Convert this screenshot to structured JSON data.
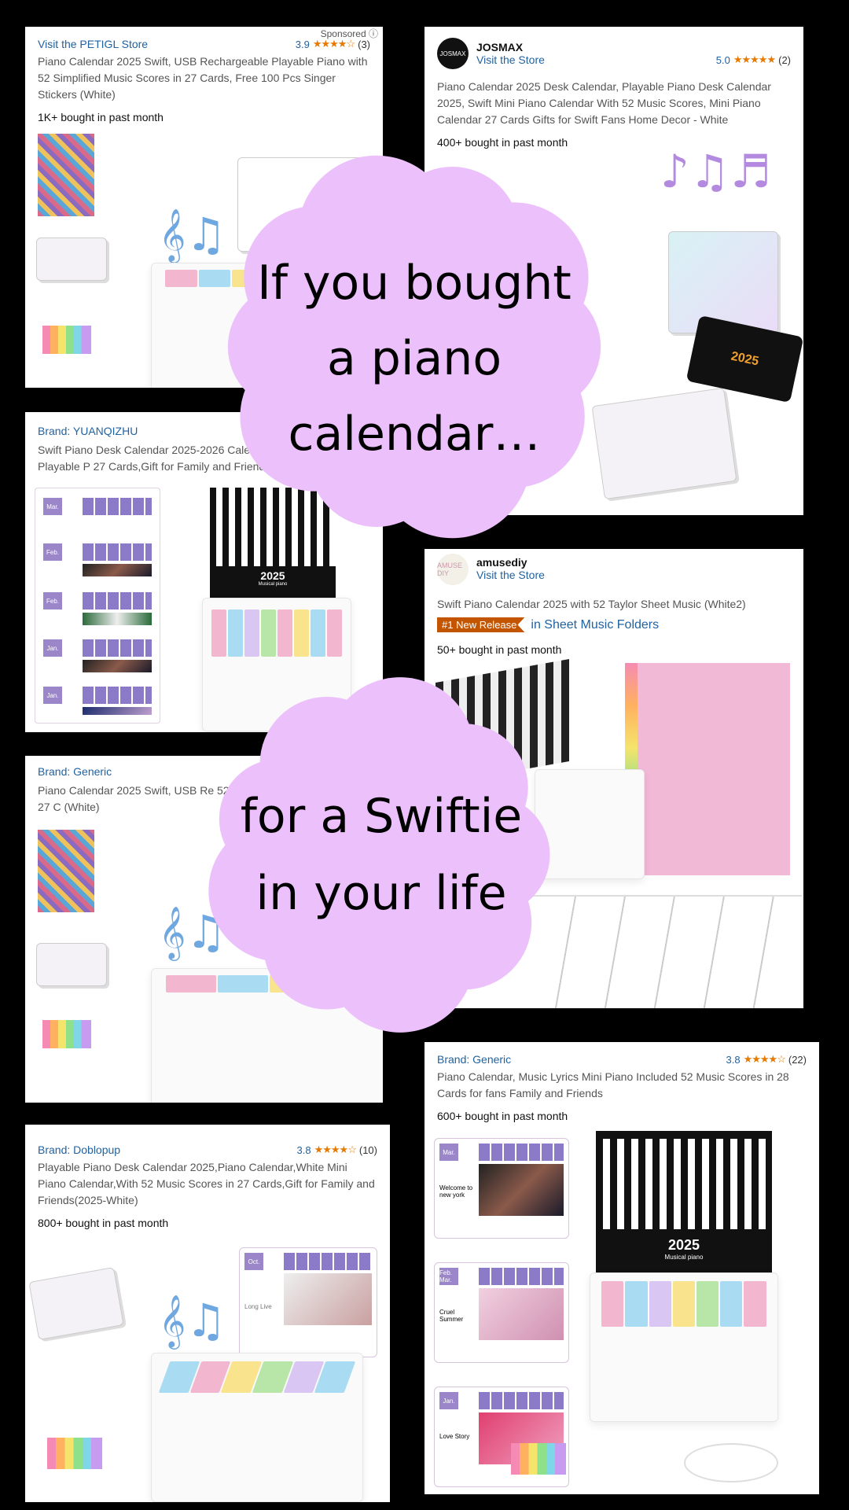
{
  "cards": [
    {
      "brand": "Visit the PETIGL Store",
      "rating": "3.9",
      "stars": "★★★★☆",
      "count": "(3)",
      "title": "Piano Calendar 2025 Swift, USB Rechargeable Playable Piano with 52 Simplified Music Scores in 27 Cards, Free 100 Pcs Singer Stickers (White)",
      "bought": "1K+ bought in past month",
      "sponsored": "Sponsored ⓘ"
    },
    {
      "store": "JOSMAX",
      "logo": "JOSMAX",
      "brand": "Visit the Store",
      "rating": "5.0",
      "stars": "★★★★★",
      "count": "(2)",
      "title": "Piano Calendar 2025 Desk Calendar, Playable Piano Desk Calendar 2025, Swift Mini Piano Calendar With 52 Music Scores, Mini Piano Calendar 27 Cards Gifts for Swift Fans Home Decor - White",
      "bought": "400+ bought in past month",
      "box_label": "2025"
    },
    {
      "brand": "Brand: YUANQIZHU",
      "title": "Swift Piano Desk Calendar 2025-2026 Calendar,USB Rechargeable Playable P 27 Cards,Gift for Family and Friends (WH",
      "months": [
        "Mar.",
        "Feb.",
        "Feb.",
        "Jan.",
        "Jan."
      ],
      "piano_year": "2025",
      "piano_sub": "Musical piano"
    },
    {
      "store": "amusediy",
      "logo": "AMUSE DIY",
      "brand": "Visit the Store",
      "title": "Swift Piano Calendar 2025 with 52 Taylor Sheet Music (White2)",
      "badge": "#1 New Release",
      "category": "in Sheet Music Folders",
      "bought": "50+ bought in past month"
    },
    {
      "brand": "Brand: Generic",
      "title": "Piano Calendar 2025 Swift, USB Re 52 Simplified Music Scores in 27 C (White)"
    },
    {
      "brand": "Brand: Generic",
      "rating": "3.8",
      "stars": "★★★★☆",
      "count": "(22)",
      "title": "Piano Calendar, Music Lyrics Mini Piano Included 52 Music Scores in 28 Cards for fans Family and Friends",
      "bought": "600+ bought in past month",
      "piano_year": "2025",
      "piano_sub": "Musical piano",
      "calendar_cards": [
        {
          "month": "Mar.",
          "song": "Welcome to new york"
        },
        {
          "month": "Feb. Mar.",
          "song": "Cruel Summer"
        },
        {
          "month": "Jan.",
          "song": "Love Story"
        }
      ]
    },
    {
      "brand": "Brand: Doblopup",
      "rating": "3.8",
      "stars": "★★★★☆",
      "count": "(10)",
      "title": "Playable Piano Desk Calendar 2025,Piano Calendar,White Mini Piano Calendar,With 52 Music Scores in 27 Cards,Gift for Family and Friends(2025-White)",
      "bought": "800+ bought in past month",
      "card_month": "Oct.",
      "card_song": "Long Live"
    }
  ],
  "overlay": {
    "cloud1_lines": [
      "If you bought",
      "a piano",
      "calendar…"
    ],
    "cloud2_lines": [
      "for a Swiftie",
      "in your life"
    ],
    "cloud_color": "#ecc0fb"
  },
  "colors": {
    "link": "#2162a1",
    "star": "#e67a00",
    "badge": "#c45500"
  }
}
